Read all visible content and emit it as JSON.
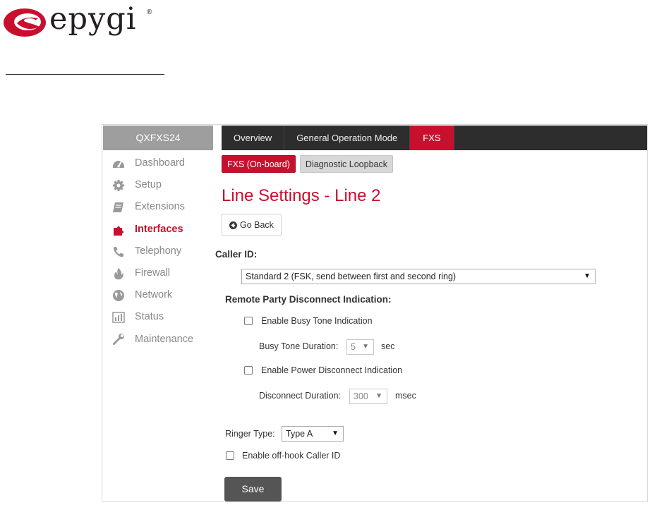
{
  "brand": {
    "logo_text": "epygi",
    "registered_mark": "®",
    "logo_color": "#c8102e"
  },
  "sidebar": {
    "device_name": "QXFXS24",
    "items": [
      {
        "label": "Dashboard",
        "icon": "dashboard-icon",
        "active": false
      },
      {
        "label": "Setup",
        "icon": "gear-icon",
        "active": false
      },
      {
        "label": "Extensions",
        "icon": "book-icon",
        "active": false
      },
      {
        "label": "Interfaces",
        "icon": "puzzle-icon",
        "active": true
      },
      {
        "label": "Telephony",
        "icon": "phone-icon",
        "active": false
      },
      {
        "label": "Firewall",
        "icon": "flame-icon",
        "active": false
      },
      {
        "label": "Network",
        "icon": "globe-icon",
        "active": false
      },
      {
        "label": "Status",
        "icon": "bar-chart-icon",
        "active": false
      },
      {
        "label": "Maintenance",
        "icon": "wrench-icon",
        "active": false
      }
    ]
  },
  "top_tabs": [
    {
      "label": "Overview",
      "active": false
    },
    {
      "label": "General Operation Mode",
      "active": false
    },
    {
      "label": "FXS",
      "active": true
    }
  ],
  "sub_tabs": [
    {
      "label": "FXS (On-board)",
      "active": true
    },
    {
      "label": "Diagnostic Loopback",
      "active": false
    }
  ],
  "page": {
    "title": "Line Settings - Line 2",
    "go_back_label": "Go Back",
    "caller_id": {
      "label": "Caller ID:",
      "value": "Standard 2 (FSK, send between first and second ring)"
    },
    "remote_party": {
      "label": "Remote Party Disconnect Indication:",
      "busy_tone_checkbox_label": "Enable Busy Tone Indication",
      "busy_tone_duration_label": "Busy Tone Duration:",
      "busy_tone_duration_value": "5",
      "busy_tone_duration_unit": "sec",
      "power_disconnect_checkbox_label": "Enable Power Disconnect Indication",
      "disconnect_duration_label": "Disconnect Duration:",
      "disconnect_duration_value": "300",
      "disconnect_duration_unit": "msec"
    },
    "ringer_type": {
      "label": "Ringer Type:",
      "value": "Type A"
    },
    "offhook_caller_id_label": "Enable off-hook Caller ID",
    "save_label": "Save",
    "dropdown_arrow": "▼"
  },
  "colors": {
    "accent": "#c8102e",
    "topbar": "#2d2d2d",
    "sidebar_header": "#9e9e9e",
    "save_button": "#555555"
  }
}
